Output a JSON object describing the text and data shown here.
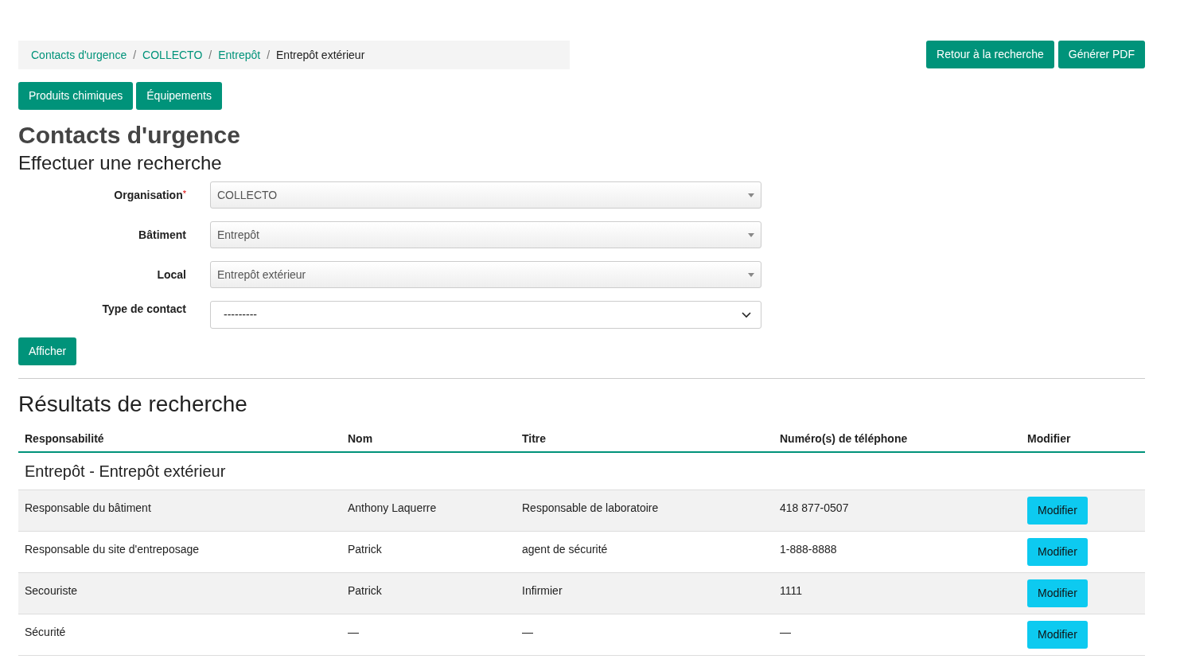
{
  "breadcrumb": [
    {
      "label": "Contacts d'urgence",
      "link": true
    },
    {
      "label": "COLLECTO",
      "link": true
    },
    {
      "label": "Entrepôt",
      "link": true
    },
    {
      "label": "Entrepôt extérieur",
      "link": false
    }
  ],
  "breadcrumb_separator": "/",
  "header_buttons": [
    "Retour à la recherche",
    "Générer PDF"
  ],
  "nav_buttons": [
    "Produits chimiques",
    "Équipements"
  ],
  "title": "Contacts d'urgence",
  "search_title": "Effectuer une recherche",
  "form_fields": [
    {
      "label": "Organisation",
      "required_mark": "*",
      "kind": "select2",
      "value": "COLLECTO"
    },
    {
      "label": "Bâtiment",
      "kind": "select2",
      "value": "Entrepôt"
    },
    {
      "label": "Local",
      "kind": "select2",
      "value": "Entrepôt extérieur"
    },
    {
      "label": "Type de contact",
      "kind": "native",
      "value": "---------"
    }
  ],
  "submit_button": "Afficher",
  "results_title": "Résultats de recherche",
  "table": {
    "columns": [
      "Responsabilité",
      "Nom",
      "Titre",
      "Numéro(s) de téléphone",
      "Modifier"
    ],
    "group_heading": "Entrepôt - Entrepôt extérieur",
    "rows": [
      {
        "cells": [
          "Responsable du bâtiment",
          "Anthony Laquerre",
          "Responsable de laboratoire",
          "418 877-0507"
        ],
        "button": "Modifier"
      },
      {
        "cells": [
          "Responsable du site d'entreposage",
          "Patrick",
          "agent de sécurité",
          "1-888-8888"
        ],
        "button": "Modifier"
      },
      {
        "cells": [
          "Secouriste",
          "Patrick",
          "Infirmier",
          "1111"
        ],
        "button": "Modifier"
      },
      {
        "cells": [
          "Sécurité",
          "—",
          "—",
          "—"
        ],
        "button": "Modifier"
      }
    ]
  }
}
